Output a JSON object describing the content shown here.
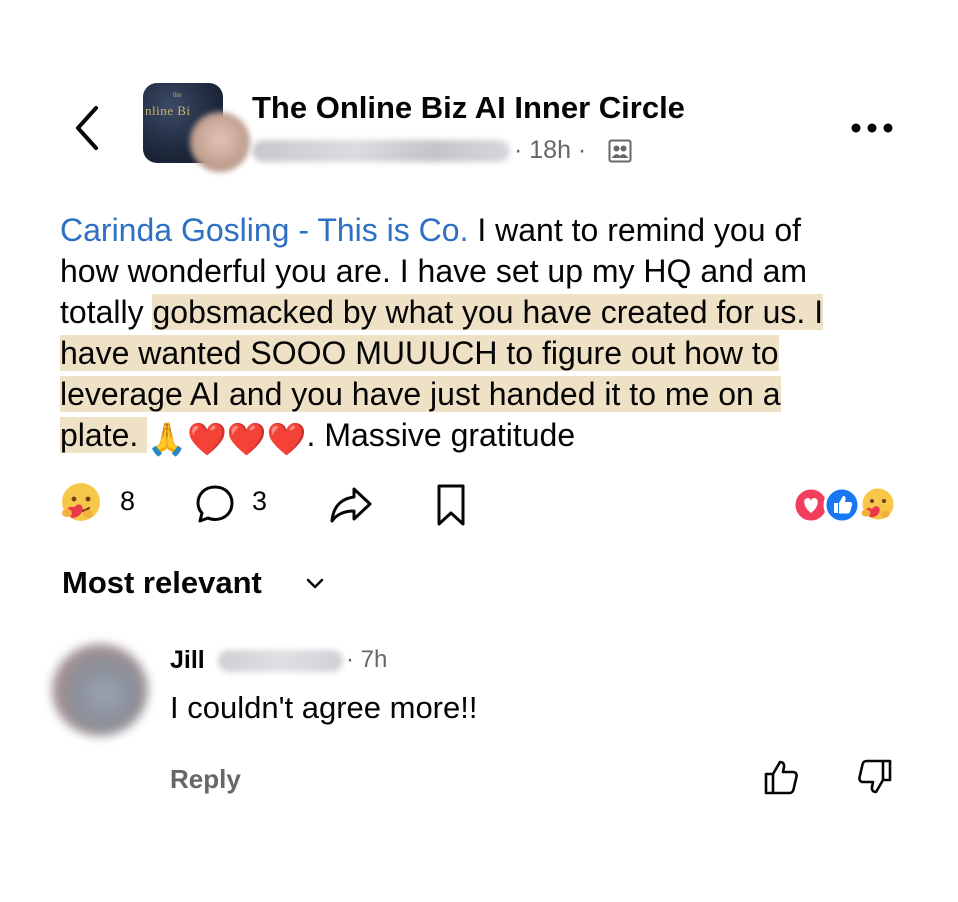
{
  "header": {
    "group_name": "The Online Biz AI Inner Circle",
    "group_logo_text": "nline Bi",
    "group_logo_small_text": "the",
    "meta_time": "· 18h ·",
    "icons": {
      "back": "chevron-left-icon",
      "group": "group-audience-icon",
      "more": "more-horizontal-icon"
    }
  },
  "post": {
    "mention": "Carinda Gosling - This is Co.",
    "line1_rest": " I want to remind you of",
    "line2": "how wonderful you are.  I have set up my HQ and am",
    "line3_plain": "totally ",
    "line3_highlight": "gobsmacked by what you have created for us. I",
    "line4_highlight": "have wanted SOOO MUUUCH to figure out how to",
    "line5_highlight": "leverage AI and you have just handed it to me on a",
    "line6_highlight": "plate.  ",
    "emojis": [
      "🙏",
      "❤️",
      "❤️",
      "❤️"
    ],
    "line6_end": ". Massive gratitude",
    "highlight_color": "#efe1c6",
    "mention_color": "#2d6fc4"
  },
  "actions": {
    "reaction_count": "8",
    "comment_count": "3",
    "icons": [
      "care-reaction-icon",
      "comment-icon",
      "share-icon",
      "save-icon"
    ],
    "reaction_summary_icons": [
      "love-reaction-icon",
      "like-reaction-icon",
      "care-reaction-icon"
    ]
  },
  "sort": {
    "label": "Most relevant"
  },
  "comment": {
    "author_first": "Jill",
    "time": "· 7h",
    "text": "I couldn't agree more!!",
    "reply_label": "Reply",
    "icons": [
      "thumbs-up-icon",
      "thumbs-down-icon"
    ]
  }
}
